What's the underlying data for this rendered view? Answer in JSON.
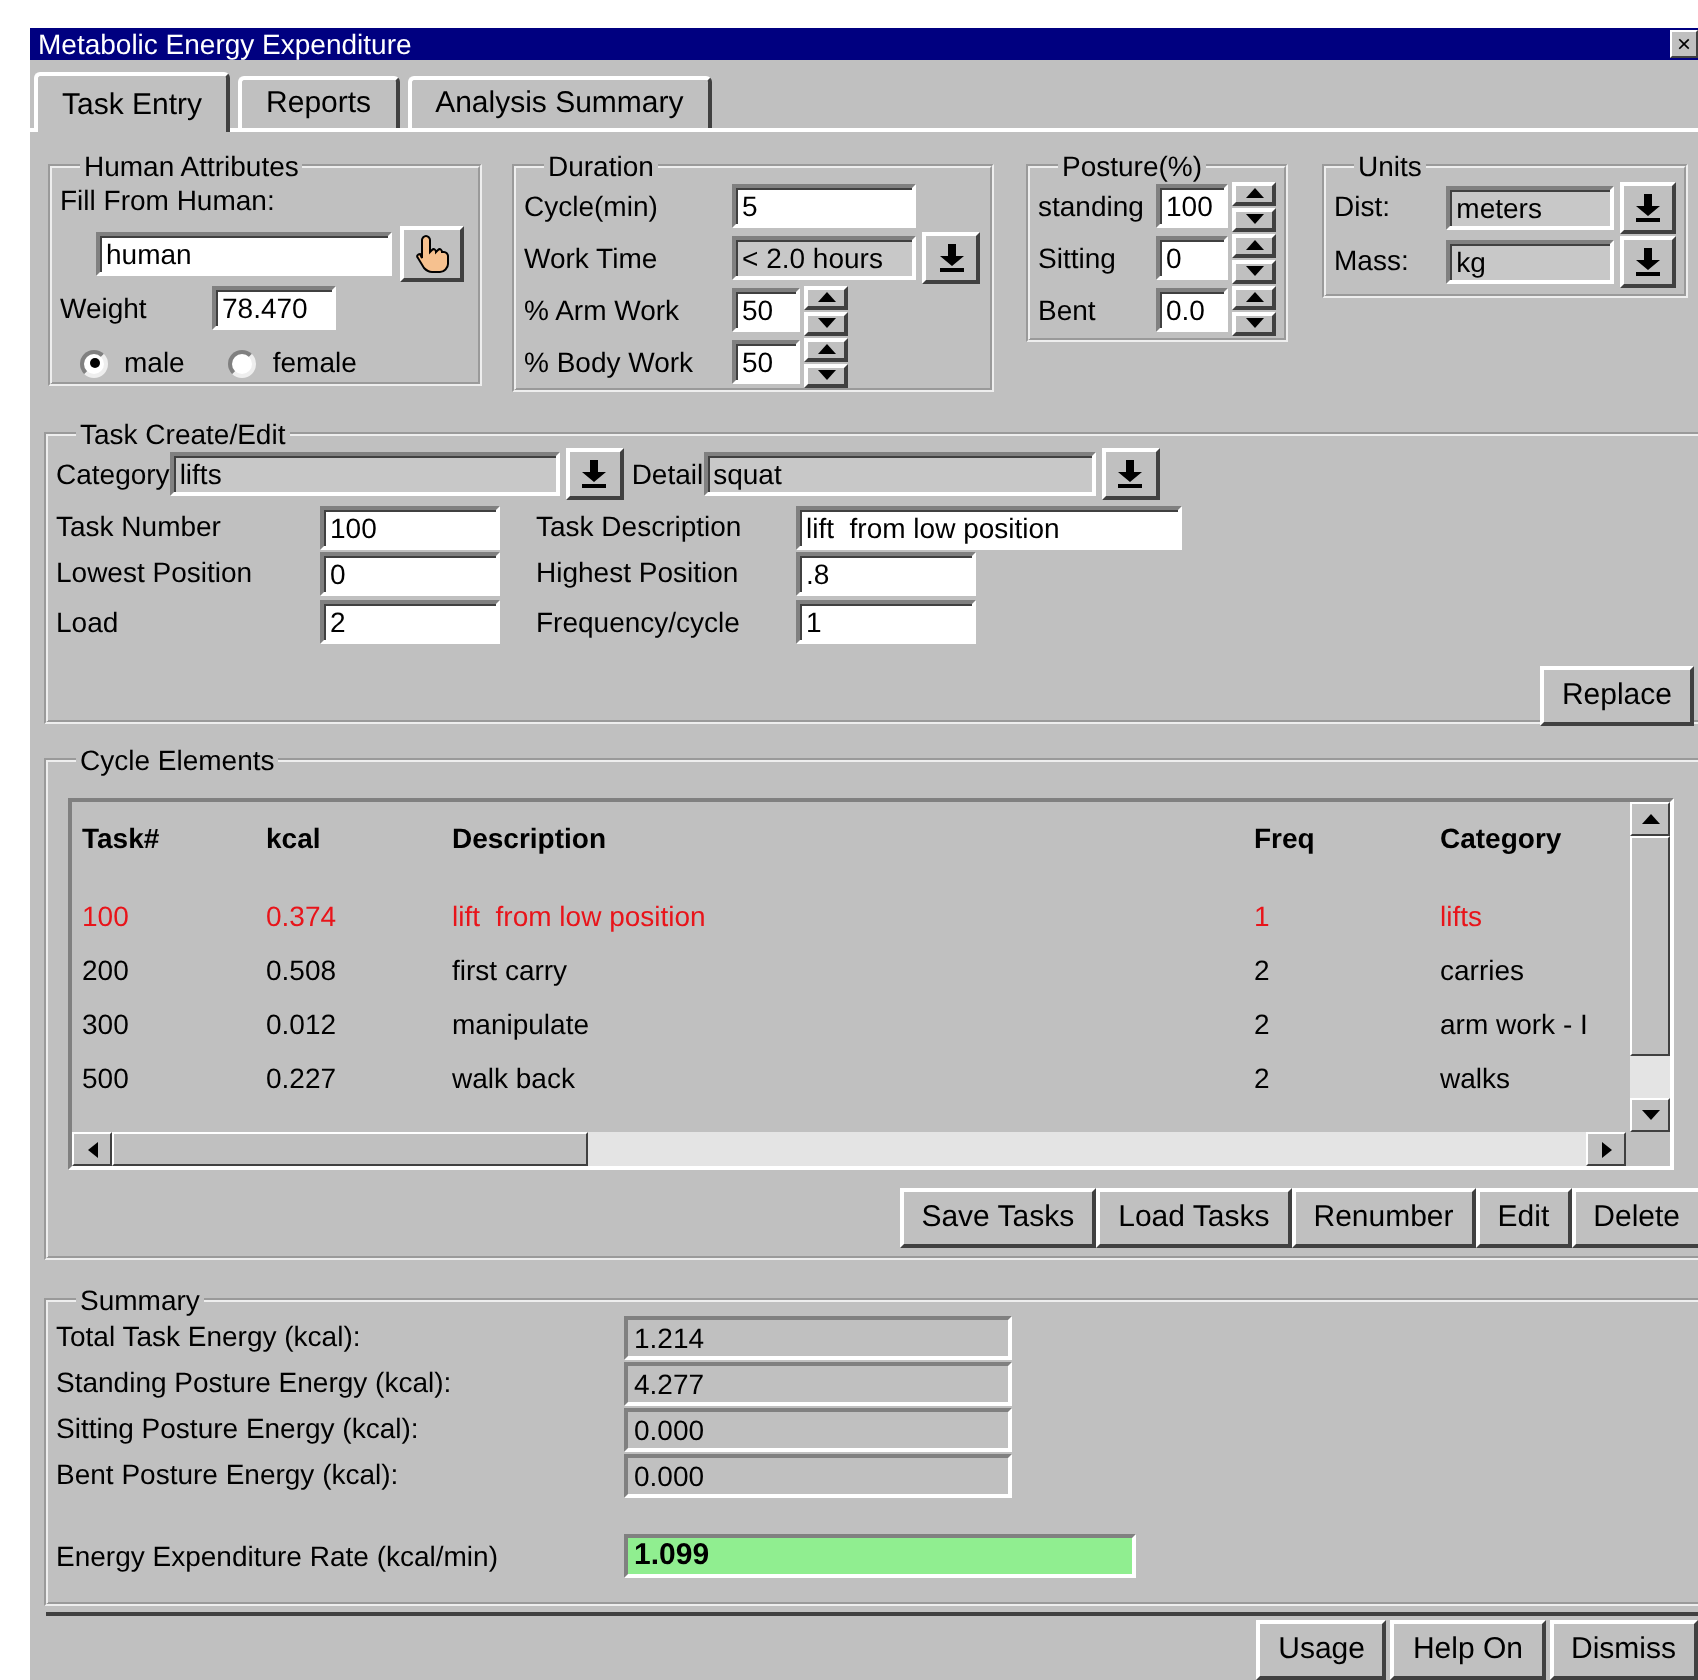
{
  "window": {
    "title": "Metabolic Energy Expenditure",
    "close": "×"
  },
  "tabs": [
    {
      "label": "Task Entry",
      "selected": true
    },
    {
      "label": "Reports",
      "selected": false
    },
    {
      "label": "Analysis Summary",
      "selected": false
    }
  ],
  "human_attributes": {
    "title": "Human Attributes",
    "fill_label": "Fill From Human:",
    "human": "human",
    "weight_label": "Weight",
    "weight": "78.470",
    "radios": [
      {
        "label": "male",
        "selected": true
      },
      {
        "label": "female",
        "selected": false
      }
    ]
  },
  "duration": {
    "title": "Duration",
    "rows": [
      {
        "kind": "field",
        "label": "Cycle(min)",
        "value": "5"
      },
      {
        "kind": "dropdown",
        "label": "Work Time",
        "value": "< 2.0 hours"
      },
      {
        "kind": "spinner",
        "label": "% Arm Work",
        "value": "50"
      },
      {
        "kind": "spinner",
        "label": "% Body Work",
        "value": "50"
      }
    ]
  },
  "posture": {
    "title": "Posture(%)",
    "rows": [
      {
        "kind": "spinner",
        "label": "standing",
        "value": "100"
      },
      {
        "kind": "spinner",
        "label": "Sitting",
        "value": "0"
      },
      {
        "kind": "spinner",
        "label": "Bent",
        "value": "0.0"
      }
    ]
  },
  "units": {
    "title": "Units",
    "rows": [
      {
        "kind": "dropdown",
        "label": "Dist:",
        "value": "meters"
      },
      {
        "kind": "dropdown",
        "label": "Mass:",
        "value": "kg"
      }
    ]
  },
  "task_edit": {
    "title": "Task Create/Edit",
    "category": {
      "label": "Category",
      "value": "lifts"
    },
    "detail": {
      "label": "Detail",
      "value": "squat"
    },
    "left": [
      {
        "label": "Task Number",
        "value": "100"
      },
      {
        "label": "Lowest Position",
        "value": "0"
      },
      {
        "label": "Load",
        "value": "2"
      }
    ],
    "right": [
      {
        "label": "Task Description",
        "value": "lift  from low position"
      },
      {
        "label": "Highest Position",
        "value": ".8"
      },
      {
        "label": "Frequency/cycle",
        "value": "1"
      }
    ],
    "replace": "Replace"
  },
  "cycle_elements": {
    "title": "Cycle Elements",
    "columns": [
      "Task#",
      "kcal",
      "Description",
      "Freq",
      "Category"
    ],
    "rows": [
      {
        "cells": [
          "100",
          "0.374",
          "lift  from low position",
          "1",
          "lifts"
        ],
        "selected": true
      },
      {
        "cells": [
          "200",
          "0.508",
          "first carry",
          "2",
          "carries"
        ],
        "selected": false
      },
      {
        "cells": [
          "300",
          "0.012",
          "manipulate",
          "2",
          "arm work - I"
        ],
        "selected": false
      },
      {
        "cells": [
          "500",
          "0.227",
          "walk back",
          "2",
          "walks"
        ],
        "selected": false
      }
    ],
    "buttons": [
      "Save Tasks",
      "Load Tasks",
      "Renumber",
      "Edit",
      "Delete"
    ]
  },
  "summary": {
    "title": "Summary",
    "rows": [
      {
        "label": "Total Task Energy (kcal):",
        "value": "1.214"
      },
      {
        "label": "Standing Posture Energy (kcal):",
        "value": "4.277"
      },
      {
        "label": "Sitting Posture Energy (kcal):",
        "value": "0.000"
      },
      {
        "label": "Bent Posture Energy (kcal):",
        "value": "0.000"
      }
    ],
    "rate": {
      "label": "Energy Expenditure Rate (kcal/min)",
      "value": "1.099"
    }
  },
  "footer_buttons": [
    "Usage",
    "Help On",
    "Dismiss"
  ]
}
